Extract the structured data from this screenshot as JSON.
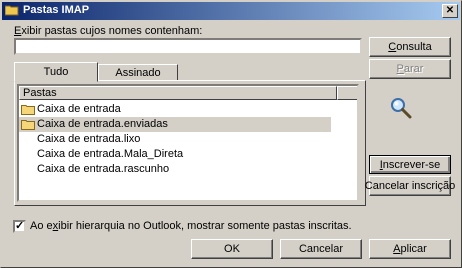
{
  "window": {
    "title": "Pastas IMAP"
  },
  "filter": {
    "label_accel": "E",
    "label_rest": "xibir pastas cujos nomes contenham:",
    "value": ""
  },
  "buttons": {
    "consulta_accel": "C",
    "consulta_rest": "onsulta",
    "parar_accel": "P",
    "parar_rest": "arar",
    "inscrever_accel": "I",
    "inscrever_rest": "nscrever-se",
    "cancelar_inscricao": "Cancelar inscrição",
    "ok": "OK",
    "cancelar": "Cancelar",
    "aplicar_accel": "A",
    "aplicar_rest": "plicar"
  },
  "tabs": [
    {
      "label": "Tudo"
    },
    {
      "label": "Assinado"
    }
  ],
  "list": {
    "header": "Pastas",
    "rows": [
      {
        "label": "Caixa de entrada",
        "icon": "folder-icon"
      },
      {
        "label": "Caixa de entrada.enviadas",
        "icon": "folder-icon"
      },
      {
        "label": "Caixa de entrada.lixo"
      },
      {
        "label": "Caixa de entrada.Mala_Direta"
      },
      {
        "label": "Caixa de entrada.rascunho"
      }
    ]
  },
  "option": {
    "checked": true,
    "check_glyph": "✓",
    "label_before": "Ao e",
    "label_accel": "x",
    "label_after": "ibir hierarquia no Outlook, mostrar somente pastas inscritas."
  },
  "icons": {
    "search": "magnifier-icon",
    "close": "close-icon"
  },
  "colors": {
    "title_start": "#0a246a",
    "title_end": "#a6caf0",
    "face": "#d4d0c8"
  }
}
